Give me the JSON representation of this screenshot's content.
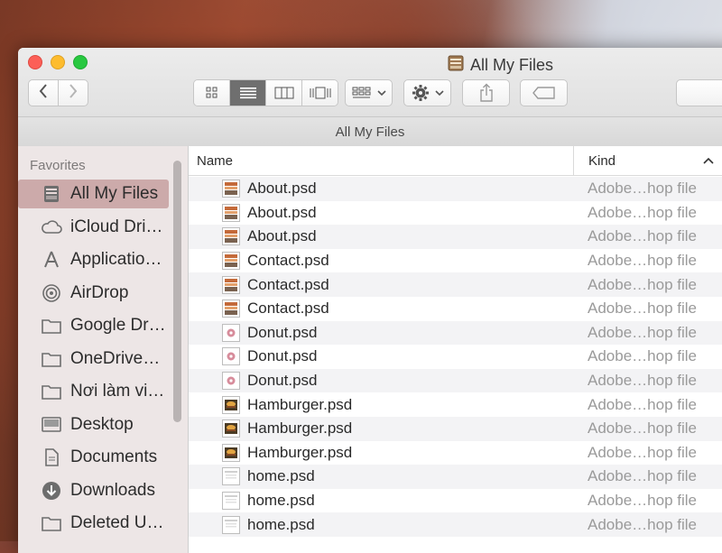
{
  "window": {
    "title": "All My Files",
    "path_title": "All My Files"
  },
  "toolbar": {
    "back": "‹",
    "forward": "›",
    "view_modes": [
      "icon-view",
      "list-view",
      "column-view",
      "cover-flow-view"
    ],
    "active_view": "list-view"
  },
  "sidebar": {
    "header": "Favorites",
    "items": [
      {
        "label": "All My Files",
        "icon": "all-my-files-icon",
        "active": true
      },
      {
        "label": "iCloud Dri…",
        "icon": "icloud-icon"
      },
      {
        "label": "Applicatio…",
        "icon": "applications-icon"
      },
      {
        "label": "AirDrop",
        "icon": "airdrop-icon"
      },
      {
        "label": "Google Dr…",
        "icon": "folder-icon"
      },
      {
        "label": "OneDrive…",
        "icon": "folder-icon"
      },
      {
        "label": "Nơi làm vi…",
        "icon": "folder-icon"
      },
      {
        "label": "Desktop",
        "icon": "desktop-icon"
      },
      {
        "label": "Documents",
        "icon": "documents-icon"
      },
      {
        "label": "Downloads",
        "icon": "downloads-icon"
      },
      {
        "label": "Deleted U…",
        "icon": "folder-icon"
      }
    ]
  },
  "table": {
    "columns": {
      "name": "Name",
      "kind": "Kind"
    },
    "rows": [
      {
        "name": "About.psd",
        "kind": "Adobe…hop file",
        "thumb": "about"
      },
      {
        "name": "About.psd",
        "kind": "Adobe…hop file",
        "thumb": "about"
      },
      {
        "name": "About.psd",
        "kind": "Adobe…hop file",
        "thumb": "about"
      },
      {
        "name": "Contact.psd",
        "kind": "Adobe…hop file",
        "thumb": "about"
      },
      {
        "name": "Contact.psd",
        "kind": "Adobe…hop file",
        "thumb": "about"
      },
      {
        "name": "Contact.psd",
        "kind": "Adobe…hop file",
        "thumb": "about"
      },
      {
        "name": "Donut.psd",
        "kind": "Adobe…hop file",
        "thumb": "donut"
      },
      {
        "name": "Donut.psd",
        "kind": "Adobe…hop file",
        "thumb": "donut"
      },
      {
        "name": "Donut.psd",
        "kind": "Adobe…hop file",
        "thumb": "donut"
      },
      {
        "name": "Hamburger.psd",
        "kind": "Adobe…hop file",
        "thumb": "burger"
      },
      {
        "name": "Hamburger.psd",
        "kind": "Adobe…hop file",
        "thumb": "burger"
      },
      {
        "name": "Hamburger.psd",
        "kind": "Adobe…hop file",
        "thumb": "burger"
      },
      {
        "name": "home.psd",
        "kind": "Adobe…hop file",
        "thumb": "home"
      },
      {
        "name": "home.psd",
        "kind": "Adobe…hop file",
        "thumb": "home"
      },
      {
        "name": "home.psd",
        "kind": "Adobe…hop file",
        "thumb": "home"
      }
    ]
  },
  "colors": {
    "sidebar_active": "#ccaaaa",
    "row_alt": "#f3f3f5",
    "kind_text": "#9a9a9a"
  }
}
